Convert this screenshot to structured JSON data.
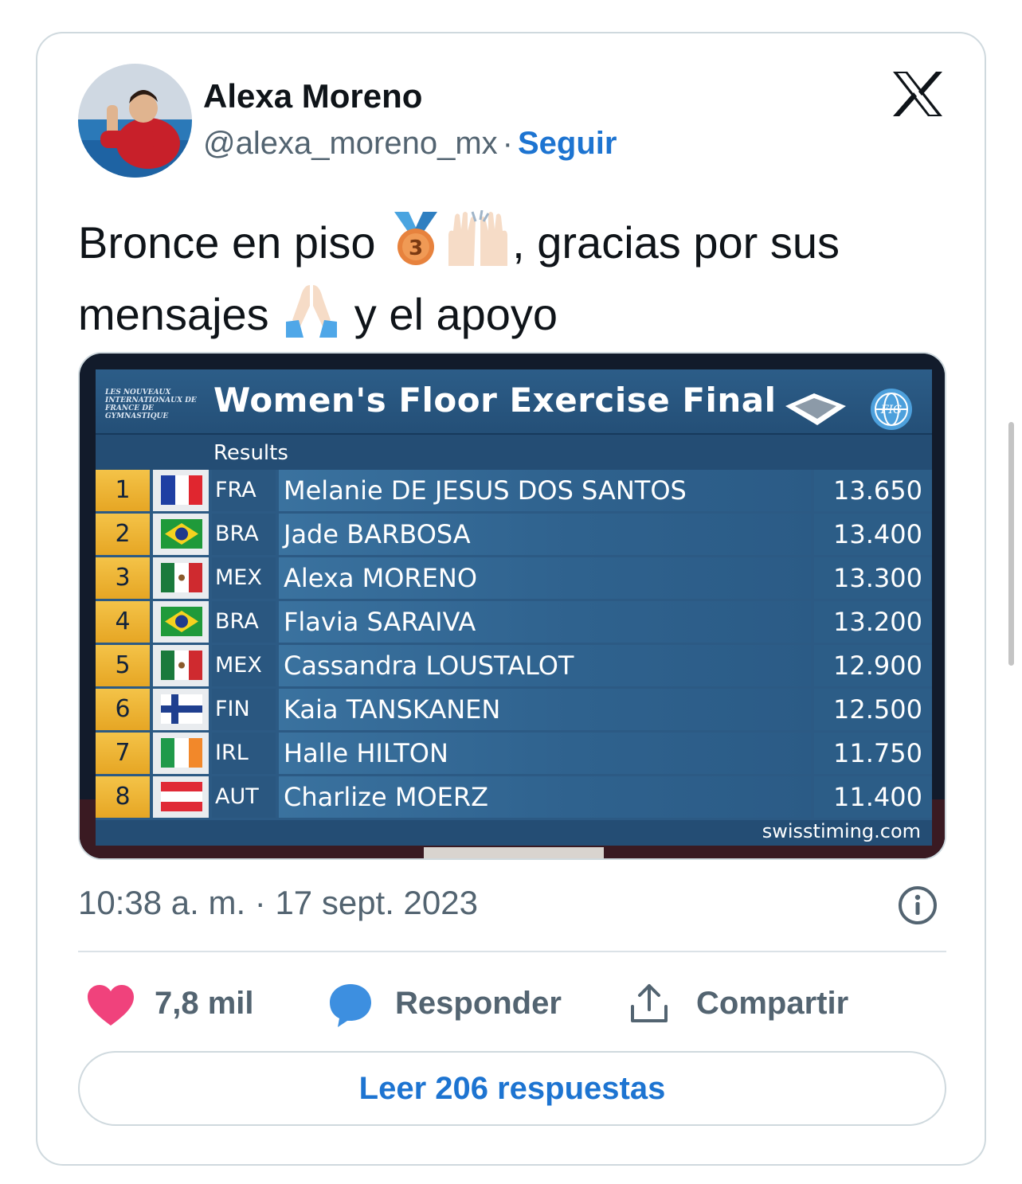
{
  "author": {
    "display_name": "Alexa Moreno",
    "handle": "@alexa_moreno_mx",
    "separator": "·",
    "follow_label": "Seguir"
  },
  "tweet": {
    "text_part1": "Bronce en piso ",
    "text_part2": ", gracias por sus",
    "text_part3": "mensajes ",
    "text_part4": " y el apoyo",
    "emoji": [
      "bronze-medal-icon",
      "raising-hands-icon",
      "folded-hands-icon"
    ]
  },
  "media": {
    "organizer_logo": "LES NOUVEAUX INTERNATIONAUX DE FRANCE DE GYMNASTIQUE",
    "title": "Women's Floor Exercise Final",
    "subtitle": "Results",
    "footer": "swisstiming.com",
    "results": [
      {
        "rank": "1",
        "noc": "FRA",
        "name": "Melanie DE JESUS DOS SANTOS",
        "score": "13.650"
      },
      {
        "rank": "2",
        "noc": "BRA",
        "name": "Jade BARBOSA",
        "score": "13.400"
      },
      {
        "rank": "3",
        "noc": "MEX",
        "name": "Alexa MORENO",
        "score": "13.300"
      },
      {
        "rank": "4",
        "noc": "BRA",
        "name": "Flavia SARAIVA",
        "score": "13.200"
      },
      {
        "rank": "5",
        "noc": "MEX",
        "name": "Cassandra LOUSTALOT",
        "score": "12.900"
      },
      {
        "rank": "6",
        "noc": "FIN",
        "name": "Kaia TANSKANEN",
        "score": "12.500"
      },
      {
        "rank": "7",
        "noc": "IRL",
        "name": "Halle HILTON",
        "score": "11.750"
      },
      {
        "rank": "8",
        "noc": "AUT",
        "name": "Charlize MOERZ",
        "score": "11.400"
      }
    ]
  },
  "meta": {
    "timestamp": "10:38 a. m. · 17 sept. 2023"
  },
  "actions": {
    "likes": "7,8 mil",
    "reply_label": "Responder",
    "share_label": "Compartir"
  },
  "read_replies_label": "Leer 206 respuestas",
  "colors": {
    "accent": "#1d74d1",
    "like": "#f0427c",
    "reply": "#3d8fe0",
    "muted": "#536471",
    "rank_gold": "#f1b93a",
    "board_blue": "#2c5a84"
  }
}
